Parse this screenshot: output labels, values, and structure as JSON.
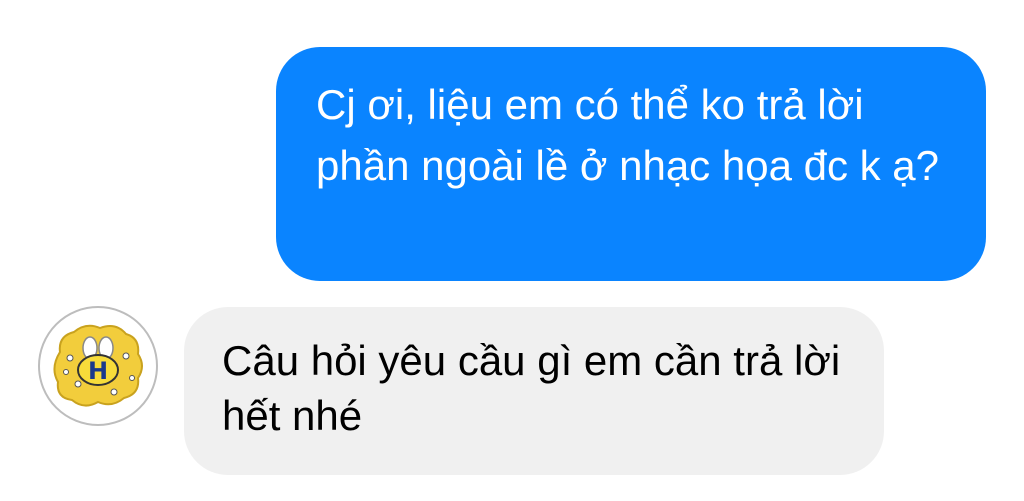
{
  "conversation": {
    "sent_message": "Cj ơi, liệu em có thể ko trả lời phần ngoài lề ở nhạc họa đc k ạ?",
    "received_message": "Câu hỏi yêu cầu gì em cần trả lời hết nhé",
    "avatar_letter": "H"
  },
  "colors": {
    "sent_bubble": "#0a84ff",
    "received_bubble": "#f0f0f0",
    "avatar_blob": "#f2cd3c",
    "avatar_border": "#bdbdbd"
  },
  "icons": {
    "avatar": "bee-logo-icon"
  }
}
